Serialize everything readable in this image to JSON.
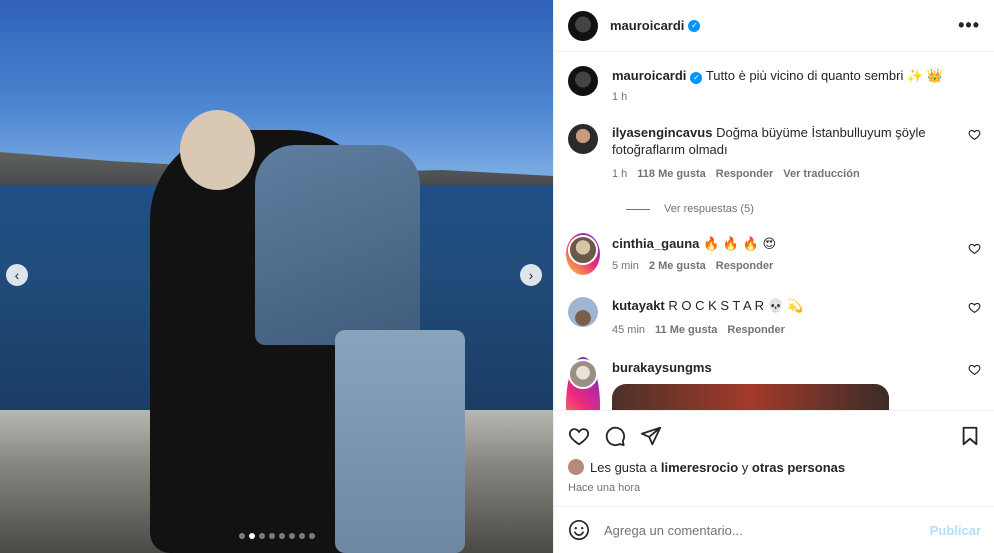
{
  "post": {
    "username": "mauroicardi",
    "more_label": "•••"
  },
  "caption": {
    "username": "mauroicardi",
    "text": "Tutto è più vicino di quanto sembri ✨ 👑",
    "time": "1 h"
  },
  "comments": [
    {
      "username": "ilyasengincavus",
      "text": "Doğma büyüme İstanbulluyum şöyle fotoğraflarım olmadı",
      "time": "1 h",
      "likes": "118 Me gusta",
      "reply": "Responder",
      "translate": "Ver traducción",
      "view_replies": "Ver respuestas (5)"
    },
    {
      "username": "cinthia_gauna",
      "text": "🔥 🔥 🔥 😍",
      "time": "5 min",
      "likes": "2 Me gusta",
      "reply": "Responder"
    },
    {
      "username": "kutayakt",
      "text": "R O C K S T A R 💀 💫",
      "time": "45 min",
      "likes": "11 Me gusta",
      "reply": "Responder"
    },
    {
      "username": "burakaysungms"
    }
  ],
  "likes_line": {
    "prefix": "Les gusta a ",
    "user": "limeresrocio",
    "middle": " y ",
    "others": "otras personas"
  },
  "post_time": "Hace una hora",
  "comment_box": {
    "placeholder": "Agrega un comentario...",
    "publish": "Publicar"
  },
  "carousel": {
    "total_slides": 8,
    "active_index": 1,
    "prev_icon": "‹",
    "next_icon": "›"
  },
  "colors": {
    "verified": "#0095f6",
    "publish_disabled": "#b2dffc"
  }
}
